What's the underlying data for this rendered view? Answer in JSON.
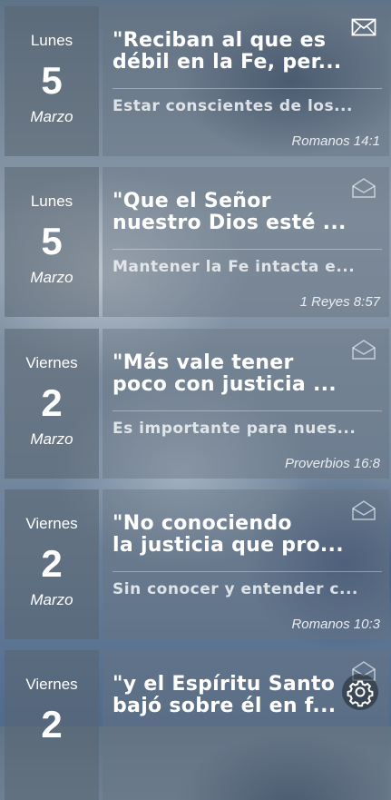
{
  "entries": [
    {
      "weekday": "Lunes",
      "day": "5",
      "month": "Marzo",
      "quote": "\"Reciban al que es\ndébil en la Fe, per...",
      "description": "Estar conscientes de los...",
      "reference": "Romanos 14:1",
      "read": false
    },
    {
      "weekday": "Lunes",
      "day": "5",
      "month": "Marzo",
      "quote": "\"Que el Señor\nnuestro Dios esté ...",
      "description": "Mantener la Fe intacta e...",
      "reference": "1 Reyes 8:57",
      "read": true
    },
    {
      "weekday": "Viernes",
      "day": "2",
      "month": "Marzo",
      "quote": "\"Más vale tener\npoco con justicia ...",
      "description": "Es importante para nues...",
      "reference": "Proverbios 16:8",
      "read": true
    },
    {
      "weekday": "Viernes",
      "day": "2",
      "month": "Marzo",
      "quote": "\"No conociendo\nla justicia que pro...",
      "description": "Sin conocer y entender c...",
      "reference": "Romanos 10:3",
      "read": true
    },
    {
      "weekday": "Viernes",
      "day": "2",
      "month": "",
      "quote": "\"y el Espíritu Santo\nbajó sobre él en f...",
      "description": "",
      "reference": "",
      "read": true
    }
  ],
  "icons": {
    "unread": "envelope-closed-icon",
    "read": "envelope-open-icon",
    "settings": "gear-icon"
  },
  "colors": {
    "text": "#ffffff",
    "card_date_bg": "#5a6470",
    "card_content_bg": "#697380"
  }
}
